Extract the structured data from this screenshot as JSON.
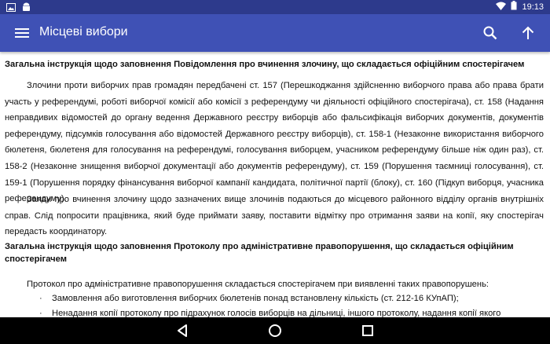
{
  "status_bar": {
    "time": "19:13",
    "left_icons": [
      "image-icon",
      "android-icon"
    ],
    "right_icons": [
      "wifi-icon",
      "battery-icon"
    ]
  },
  "app_bar": {
    "title": "Місцеві вибори",
    "icons": [
      "menu-icon",
      "search-icon",
      "arrow-up-icon"
    ],
    "color": "#3f51b5"
  },
  "content": {
    "heading1": "Загальна інструкція щодо заповнення Повідомлення про вчинення злочину, що складається офіційним спостерігачем",
    "paragraph1": "Злочини проти виборчих прав громадян передбачені ст. 157 (Перешкоджання здійсненню виборчого права або права брати участь у референдумі, роботі виборчої комісії або комісії з референдуму чи діяльності офіційного спостерігача), ст. 158 (Надання неправдивих відомостей до органу ведення Державного реєстру виборців або фальсифікація виборчих документів, документів референдуму, підсумків голосування або відомостей Державного реєстру виборців), ст. 158-1 (Незаконне використання виборчого бюлетеня, бюлетеня для голосування на референдумі, голосування виборцем, учасником референдуму більше ніж один раз), ст. 158-2 (Незаконне знищення виборчої документації або документів референдуму), ст. 159 (Порушення таємниці голосування), ст. 159-1 (Порушення порядку фінансування виборчої кампанії кандидата, політичної партії (блоку), ст. 160 (Підкуп виборця, учасника референдуму).",
    "paragraph2": "Заяви про вчинення злочину щодо зазначених вище злочинів подаються до місцевого районного відділу органів внутрішніх справ. Слід попросити працівника, який буде приймати заяву, поставити відмітку про отримання заяви на копії, яку спостерігач передасть координатору.",
    "heading2": "Загальна інструкція щодо заповнення Протоколу про адміністративне правопорушення, що складається офіційним спостерігачем",
    "paragraph3": "Протокол про адміністративне правопорушення складається спостерігачем при виявленні таких правопорушень:",
    "bullets": [
      "Замовлення або виготовлення виборчих бюлетенів понад встановлену кількість (ст. 212-16 КУпАП);",
      "Ненадання копії протоколу про підрахунок голосів виборців на дільниці, іншого протоколу, надання копії якого"
    ]
  },
  "nav_bar": {
    "icons": [
      "back-icon",
      "home-icon",
      "recents-icon"
    ]
  }
}
